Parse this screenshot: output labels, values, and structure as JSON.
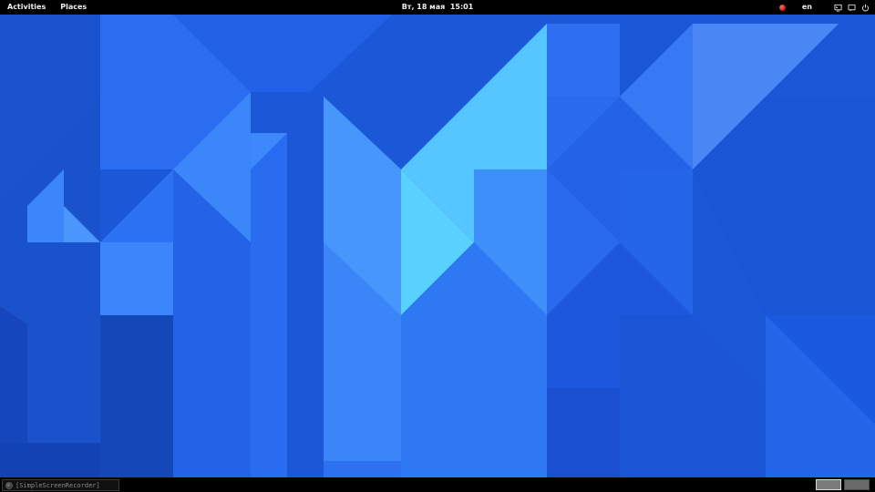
{
  "topbar": {
    "activities_label": "Activities",
    "places_label": "Places",
    "clock": "Вт, 18 мая  15:01",
    "language": "en",
    "icons": [
      "record-indicator-icon",
      "display-icon",
      "chat-icon",
      "power-icon"
    ]
  },
  "taskbar": {
    "window_title": "[SimpleScreenRecorder]",
    "workspaces": [
      {
        "name": "workspace-1",
        "active": true
      },
      {
        "name": "workspace-2",
        "active": false
      }
    ]
  },
  "colors": {
    "wallpaper_base": "#1b57d6",
    "wallpaper_light": "#55c6ff",
    "panel_bg": "#000000",
    "record_indicator": "#d0151f"
  }
}
